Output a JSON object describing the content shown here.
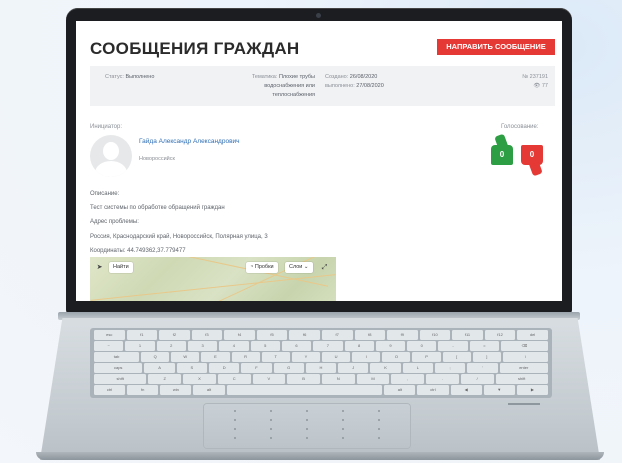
{
  "page": {
    "title": "СООБЩЕНИЯ ГРАЖДАН",
    "send_button": "НАПРАВИТЬ СООБЩЕНИЕ"
  },
  "info": {
    "status_label": "Статус:",
    "status_value": "Выполнено",
    "topic_label": "Тематика:",
    "topic_value_1": "Плохие трубы",
    "topic_value_2": "водоснабжения или",
    "topic_value_3": "теплоснабжения",
    "created_label": "Создано:",
    "created_value": "26/08/2020",
    "done_label": "выполнено:",
    "done_value": "27/08/2020",
    "number": "№ 237191",
    "views": "77"
  },
  "author": {
    "label": "Инициатор:",
    "name": "Гайда Александр Александрович",
    "city": "Новороссийск"
  },
  "votes": {
    "label": "Голосование:",
    "up": "0",
    "down": "0"
  },
  "description": {
    "label": "Описание:",
    "text": "Тест системы по обработке обращений граждан",
    "address_label": "Адрес проблемы:",
    "address": "Россия, Краснодарский край, Новороссийск, Полярная улица, 3",
    "coords": "Координаты: 44.749362,37.779477"
  },
  "map": {
    "find": "Найти",
    "traffic": "Пробки",
    "layers": "Слои"
  },
  "keyboard": {
    "row1": [
      "esc",
      "f1",
      "f2",
      "f3",
      "f4",
      "f5",
      "f6",
      "f7",
      "f8",
      "f9",
      "f10",
      "f11",
      "f12",
      "del"
    ],
    "row2": [
      "~",
      "1",
      "2",
      "3",
      "4",
      "5",
      "6",
      "7",
      "8",
      "9",
      "0",
      "-",
      "=",
      "⌫"
    ],
    "row3": [
      "tab",
      "Q",
      "W",
      "E",
      "R",
      "T",
      "Y",
      "U",
      "I",
      "O",
      "P",
      "[",
      "]",
      "\\"
    ],
    "row4": [
      "caps",
      "A",
      "S",
      "D",
      "F",
      "G",
      "H",
      "J",
      "K",
      "L",
      ";",
      "'",
      "enter"
    ],
    "row5": [
      "shift",
      "Z",
      "X",
      "C",
      "V",
      "B",
      "N",
      "M",
      ",",
      ".",
      "/",
      "shift"
    ],
    "row6": [
      "ctrl",
      "fn",
      "win",
      "alt",
      "",
      "alt",
      "ctrl",
      "◀",
      "▼",
      "▶"
    ]
  },
  "colors": {
    "accent_red": "#e53935",
    "accent_green": "#2e9e44",
    "link_blue": "#2f6fb6"
  }
}
